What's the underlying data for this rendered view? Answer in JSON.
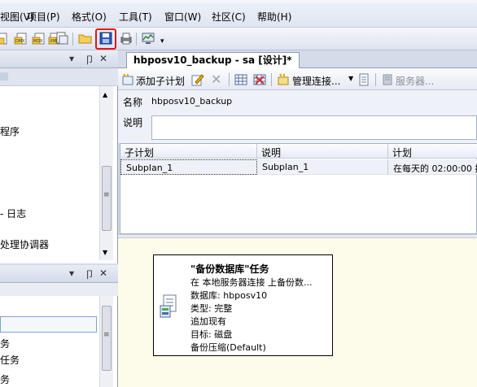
{
  "menu": [
    {
      "label": "视图(V)"
    },
    {
      "label": "项目(P)"
    },
    {
      "label": "格式(O)"
    },
    {
      "label": "工具(T)"
    },
    {
      "label": "窗口(W)"
    },
    {
      "label": "社区(C)"
    },
    {
      "label": "帮助(H)"
    }
  ],
  "toolbar": {
    "save_highlight_color": "#e8140f",
    "icons": [
      "new-query-icon",
      "db-query-icon",
      "analysis-query-icon",
      "xml-query-icon",
      "add-item-icon",
      "open-icon",
      "save-icon",
      "print-icon",
      "activity-monitor-icon"
    ]
  },
  "left_top_panel": {
    "items": [
      "程序",
      "- 日志",
      "处理协调器"
    ],
    "pin_glyph": "▾ 卩 ✕"
  },
  "left_bottom_panel": {
    "items": [
      "务",
      "  任务",
      "务"
    ],
    "pin_glyph": "▾ 卩 ✕"
  },
  "document": {
    "tab_title": "hbposv10_backup - sa [设计]*"
  },
  "designer_toolbar": {
    "add_subplan": "添加子计划",
    "manage_connections": "管理连接...",
    "servers": "服务器..."
  },
  "properties": {
    "name_label": "名称",
    "name_value": "hbposv10_backup",
    "description_label": "说明",
    "description_value": ""
  },
  "subplan_grid": {
    "columns": [
      "子计划",
      "说明",
      "计划"
    ],
    "rows": [
      {
        "subplan": "Subplan_1",
        "description": "Subplan_1",
        "schedule": "在每天的 02:00:00 执"
      }
    ]
  },
  "task": {
    "title": "\"备份数据库\"任务",
    "lines": [
      "在 本地服务器连接 上备份数...",
      "数据库: hbposv10",
      "类型: 完整",
      "追加现有",
      "目标: 磁盘",
      "备份压缩(Default)"
    ]
  }
}
